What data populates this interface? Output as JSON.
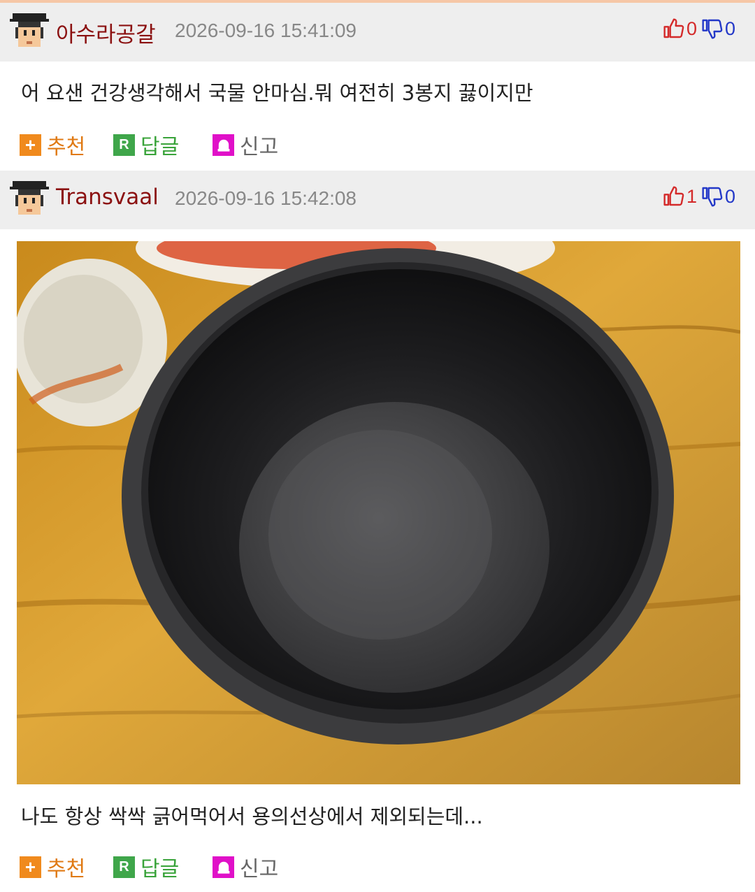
{
  "comments": [
    {
      "nick": "아수라공갈",
      "date": "2026-09-16 15:41:09",
      "up": "0",
      "down": "0",
      "text": "어 요샌 건강생각해서 국물 안마심.뭐 여전히 3봉지 끓이지만"
    },
    {
      "nick": "Transvaal",
      "date": "2026-09-16 15:42:08",
      "up": "1",
      "down": "0",
      "text": "나도 항상 싹싹 긁어먹어서 용의선상에서 제외되는데..."
    }
  ],
  "actions": {
    "recommend": "추천",
    "reply": "답글",
    "report": "신고",
    "reply_icon": "R",
    "recommend_icon": "+"
  },
  "icons": {
    "avatar": "pixel-avatar-icon",
    "thumbs_up": "thumbs-up-icon",
    "thumbs_down": "thumbs-down-icon",
    "report": "siren-icon"
  },
  "colors": {
    "nick": "#8b1111",
    "up": "#d42a2a",
    "down": "#2338c8",
    "recommend": "#e07a14",
    "reply": "#39a33a",
    "report_icon": "#e010c8",
    "header_bg": "#eeeeee"
  }
}
